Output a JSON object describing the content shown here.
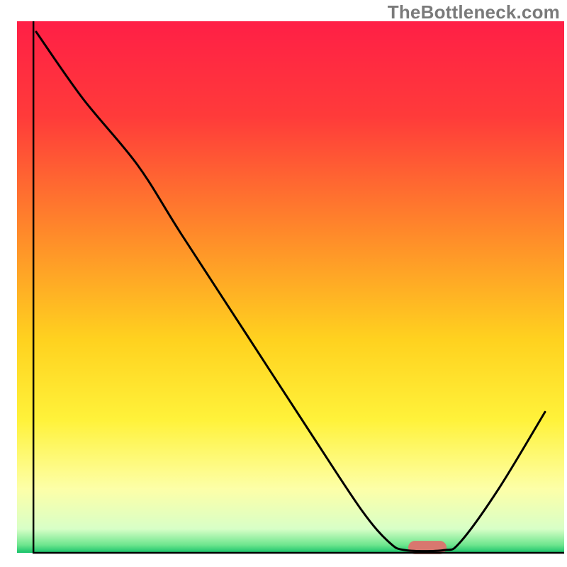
{
  "watermark": "TheBottleneck.com",
  "chart_data": {
    "type": "line",
    "title": "",
    "xlabel": "",
    "ylabel": "",
    "xlim": [
      0,
      100
    ],
    "ylim": [
      0,
      100
    ],
    "gradient_stops": [
      {
        "offset": 0.0,
        "color": "#ff1f46"
      },
      {
        "offset": 0.18,
        "color": "#ff3b3a"
      },
      {
        "offset": 0.4,
        "color": "#ff8a2a"
      },
      {
        "offset": 0.6,
        "color": "#ffd21f"
      },
      {
        "offset": 0.75,
        "color": "#fff23a"
      },
      {
        "offset": 0.88,
        "color": "#fdffa8"
      },
      {
        "offset": 0.955,
        "color": "#d8ffc7"
      },
      {
        "offset": 0.985,
        "color": "#6fe68e"
      },
      {
        "offset": 1.0,
        "color": "#17c26a"
      }
    ],
    "curve": [
      {
        "x": 3.5,
        "y": 98.0
      },
      {
        "x": 12.0,
        "y": 85.5
      },
      {
        "x": 22.0,
        "y": 73.0
      },
      {
        "x": 30.0,
        "y": 60.0
      },
      {
        "x": 42.0,
        "y": 41.0
      },
      {
        "x": 54.0,
        "y": 22.0
      },
      {
        "x": 63.0,
        "y": 8.0
      },
      {
        "x": 68.0,
        "y": 2.0
      },
      {
        "x": 71.0,
        "y": 0.5
      },
      {
        "x": 78.0,
        "y": 0.5
      },
      {
        "x": 81.0,
        "y": 2.0
      },
      {
        "x": 88.0,
        "y": 12.0
      },
      {
        "x": 96.5,
        "y": 26.5
      }
    ],
    "marker": {
      "x": 75.0,
      "y": 1.0,
      "width": 7.0,
      "height": 2.5,
      "color": "#d8776f"
    },
    "axes": {
      "left_x": 3.0,
      "bottom_y": 0.0,
      "width": 97.0,
      "stroke": "#000000",
      "stroke_width": 2.5
    }
  }
}
